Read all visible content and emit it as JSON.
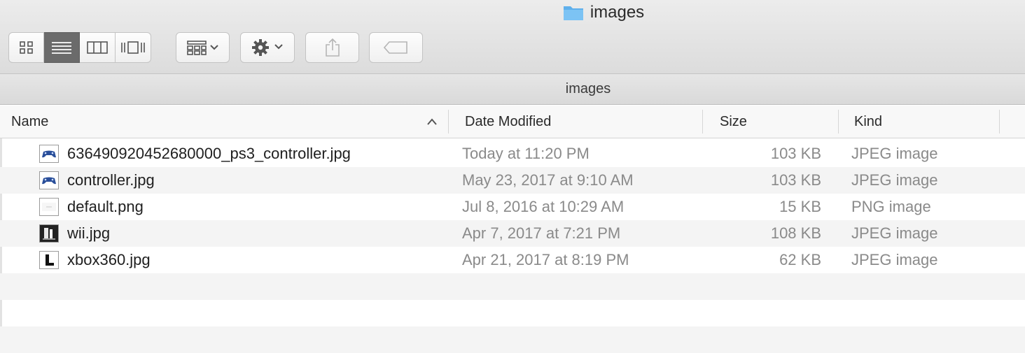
{
  "window": {
    "title": "images"
  },
  "toolbar": {
    "view_buttons": [
      {
        "name": "icon-view",
        "icon": "grid-icon",
        "active": false
      },
      {
        "name": "list-view",
        "icon": "list-icon",
        "active": true
      },
      {
        "name": "column-view",
        "icon": "columns-icon",
        "active": false
      },
      {
        "name": "gallery-view",
        "icon": "coverflow-icon",
        "active": false
      }
    ],
    "arrange_icon": "arrange-icon",
    "action_icon": "gear-icon",
    "share_icon": "share-icon",
    "tag_icon": "tag-icon"
  },
  "pathbar": {
    "label": "images"
  },
  "columns": {
    "name": "Name",
    "date": "Date Modified",
    "size": "Size",
    "kind": "Kind",
    "sort_indicator": "chevron-up-icon"
  },
  "files": [
    {
      "name": "636490920452680000_ps3_controller.jpg",
      "date": "Today at 11:20 PM",
      "size": "103 KB",
      "kind": "JPEG image",
      "thumb": "controller"
    },
    {
      "name": "controller.jpg",
      "date": "May 23, 2017 at 9:10 AM",
      "size": "103 KB",
      "kind": "JPEG image",
      "thumb": "controller"
    },
    {
      "name": "default.png",
      "date": "Jul 8, 2016 at 10:29 AM",
      "size": "15 KB",
      "kind": "PNG image",
      "thumb": "blank"
    },
    {
      "name": "wii.jpg",
      "date": "Apr 7, 2017 at 7:21 PM",
      "size": "108 KB",
      "kind": "JPEG image",
      "thumb": "wii"
    },
    {
      "name": "xbox360.jpg",
      "date": "Apr 21, 2017 at 8:19 PM",
      "size": "62 KB",
      "kind": "JPEG image",
      "thumb": "xbox"
    }
  ],
  "colors": {
    "accent_folder": "#5fb0ec",
    "active_segment": "#6b6b6b",
    "row_alt": "#f4f4f4",
    "secondary_text": "#8a8a8a"
  }
}
